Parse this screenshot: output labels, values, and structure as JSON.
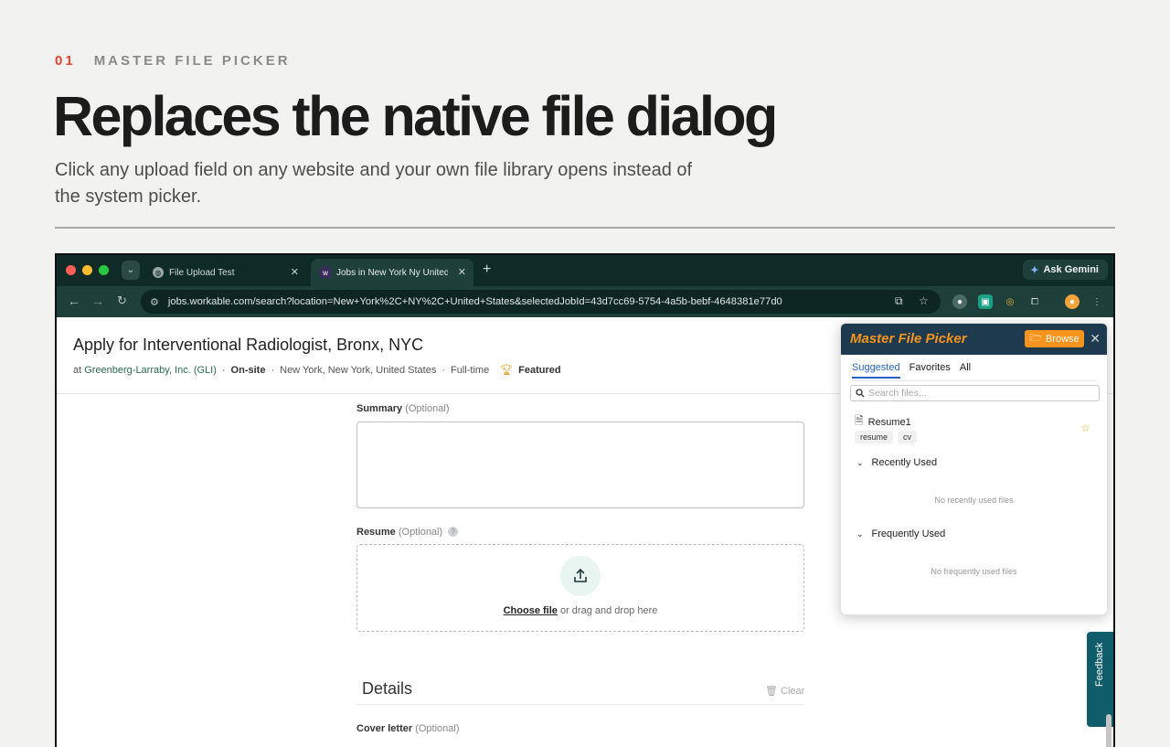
{
  "header": {
    "step_number": "01",
    "step_label": "MASTER FILE PICKER",
    "headline": "Replaces the native file dialog",
    "subtitle": "Click any upload field on any website and your own file library opens instead of the system picker."
  },
  "browser": {
    "tabs": [
      {
        "label": "File Upload Test",
        "active": false
      },
      {
        "label": "Jobs in New York Ny United S",
        "active": true
      }
    ],
    "ask_gemini_label": "Ask Gemini",
    "url": "jobs.workable.com/search?location=New+York%2C+NY%2C+United+States&selectedJobId=43d7cc69-5754-4a5b-bebf-4648381e77d0"
  },
  "job": {
    "title": "Apply for Interventional Radiologist, Bronx, NYC",
    "company_prefix": "at",
    "company": "Greenberg-Larraby, Inc. (GLI)",
    "workplace": "On-site",
    "location": "New York, New York, United States",
    "type": "Full-time",
    "featured": "Featured",
    "separator": "·"
  },
  "form": {
    "summary_label": "Summary",
    "summary_optional": "(Optional)",
    "resume_label": "Resume",
    "resume_optional": "(Optional)",
    "resume_help": "?",
    "choose_file": "Choose file",
    "drag_text": "or drag and drop here",
    "details_title": "Details",
    "clear_label": "Clear",
    "cover_letter_label": "Cover letter",
    "cover_letter_optional": "(Optional)",
    "feedback_label": "Feedback"
  },
  "picker": {
    "title": "Master File Picker",
    "browse_label": "Browse",
    "tabs": [
      "Suggested",
      "Favorites",
      "All"
    ],
    "search_placeholder": "Search files...",
    "file_name": "Resume1",
    "file_tags": [
      "resume",
      "cv"
    ],
    "recent_title": "Recently Used",
    "recent_empty": "No recently used files",
    "frequent_title": "Frequently Used",
    "frequent_empty": "No frequently used files"
  },
  "colors": {
    "accent_red": "#e5452f",
    "picker_orange": "#f7941d",
    "picker_header": "#1e3a4f",
    "browser_chrome": "#1f3f3b"
  }
}
